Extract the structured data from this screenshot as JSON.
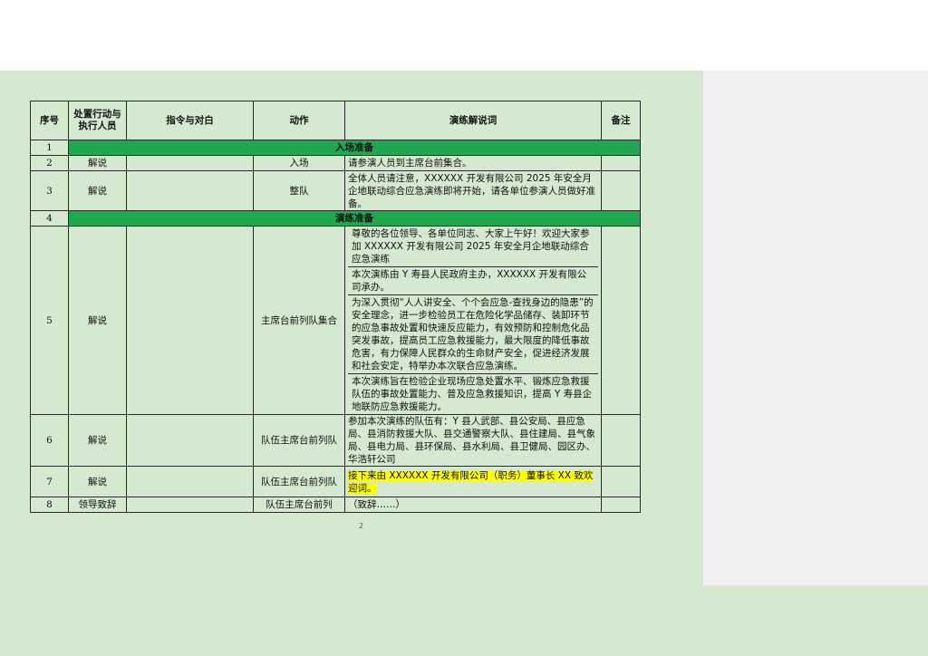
{
  "headers": {
    "seq": "序号",
    "actor": "处置行动与执行人员",
    "command": "指令与对白",
    "action": "动作",
    "commentary": "演练解说词",
    "remark": "备注"
  },
  "rows": [
    {
      "seq": "1",
      "section": "入场准备"
    },
    {
      "seq": "2",
      "actor": "解说",
      "action": "入场",
      "commentary": [
        "请参演人员到主席台前集合。"
      ]
    },
    {
      "seq": "3",
      "actor": "解说",
      "action": "整队",
      "commentary": [
        "全体人员请注意，XXXXXX 开发有限公司 2025 年安全月企地联动综合应急演练即将开始，请各单位参演人员做好准备。"
      ]
    },
    {
      "seq": "4",
      "section": "演练准备"
    },
    {
      "seq": "5",
      "actor": "解说",
      "action": "主席台前列队集合",
      "commentary": [
        "尊敬的各位领导、各单位同志、大家上午好！欢迎大家参加 XXXXXX 开发有限公司 2025 年安全月企地联动综合应急演练",
        "本次演练由 Y 寿县人民政府主办，XXXXXX 开发有限公司承办。",
        "为深入贯彻“人人讲安全、个个会应急-查找身边的隐患”的安全理念，进一步检验员工在危险化学品储存、装卸环节的应急事故处置和快速反应能力，有效预防和控制危化品突发事故，提高员工应急救援能力，最大限度的降低事故危害，有力保障人民群众的生命财产安全，促进经济发展和社会安定，特举办本次联合应急演练。",
        "本次演练旨在检验企业现场应急处置水平、锻炼应急救援队伍的事故处置能力、普及应急救援知识，提高 Y 寿县企地联防应急救援能力。"
      ]
    },
    {
      "seq": "6",
      "actor": "解说",
      "action": "队伍主席台前列队",
      "commentary": [
        "参加本次演练的队伍有：Y 县人武部、县公安局、县应急局、县消防救援大队、县交通警察大队、县住建局、县气象局、县电力局、县环保局、县水利局、县卫健局、园区办、华浩轩公司"
      ]
    },
    {
      "seq": "7",
      "actor": "解说",
      "action": "队伍主席台前列队",
      "commentary": [
        "接下来由 XXXXXX 开发有限公司（职务）董事长 XX 致欢迎词。"
      ],
      "highlight": true
    },
    {
      "seq": "8",
      "actor": "领导致辞",
      "action": "队伍主席台前列",
      "commentary": [
        "（致辞……）"
      ]
    }
  ],
  "page_number": "2",
  "colors": {
    "section": "#1fa84f",
    "highlight": "#ffff00",
    "background": "#d4e9cf"
  }
}
